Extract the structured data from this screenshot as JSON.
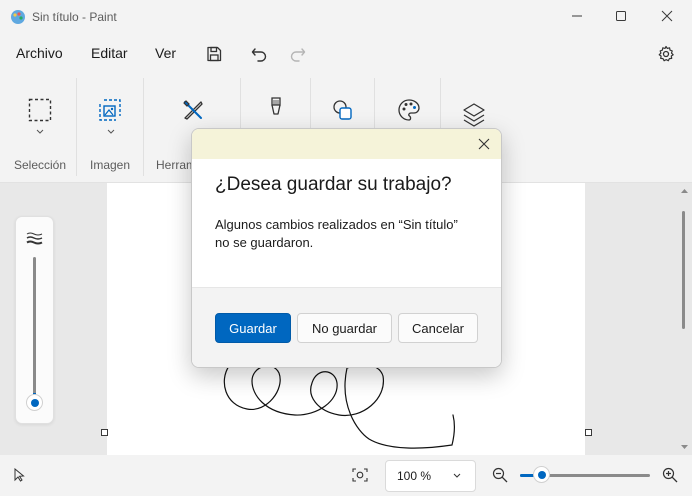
{
  "window": {
    "title": "Sin título - Paint"
  },
  "menu": {
    "file": "Archivo",
    "edit": "Editar",
    "view": "Ver"
  },
  "ribbon": {
    "groups": [
      {
        "label": "Selección"
      },
      {
        "label": "Imagen"
      },
      {
        "label": "Herram"
      }
    ]
  },
  "dialog": {
    "heading": "¿Desea guardar su trabajo?",
    "body_line1": "Algunos cambios realizados en “Sin título”",
    "body_line2": "no se guardaron.",
    "save_label": "Guardar",
    "dont_save_label": "No guardar",
    "cancel_label": "Cancelar"
  },
  "status": {
    "zoom": "100 %"
  },
  "colors": {
    "accent": "#0067c0",
    "dialog_title_bg": "#f5f3d9"
  },
  "icons": [
    "paint-app-icon",
    "minimize-icon",
    "maximize-icon",
    "close-icon",
    "save-icon",
    "undo-icon",
    "redo-icon",
    "settings-icon",
    "selection-icon",
    "image-icon",
    "tools-icon",
    "brush-icon",
    "shapes-icon",
    "palette-icon",
    "layers-icon",
    "pointer-icon",
    "fit-icon",
    "zoom-out-icon",
    "zoom-in-icon"
  ]
}
